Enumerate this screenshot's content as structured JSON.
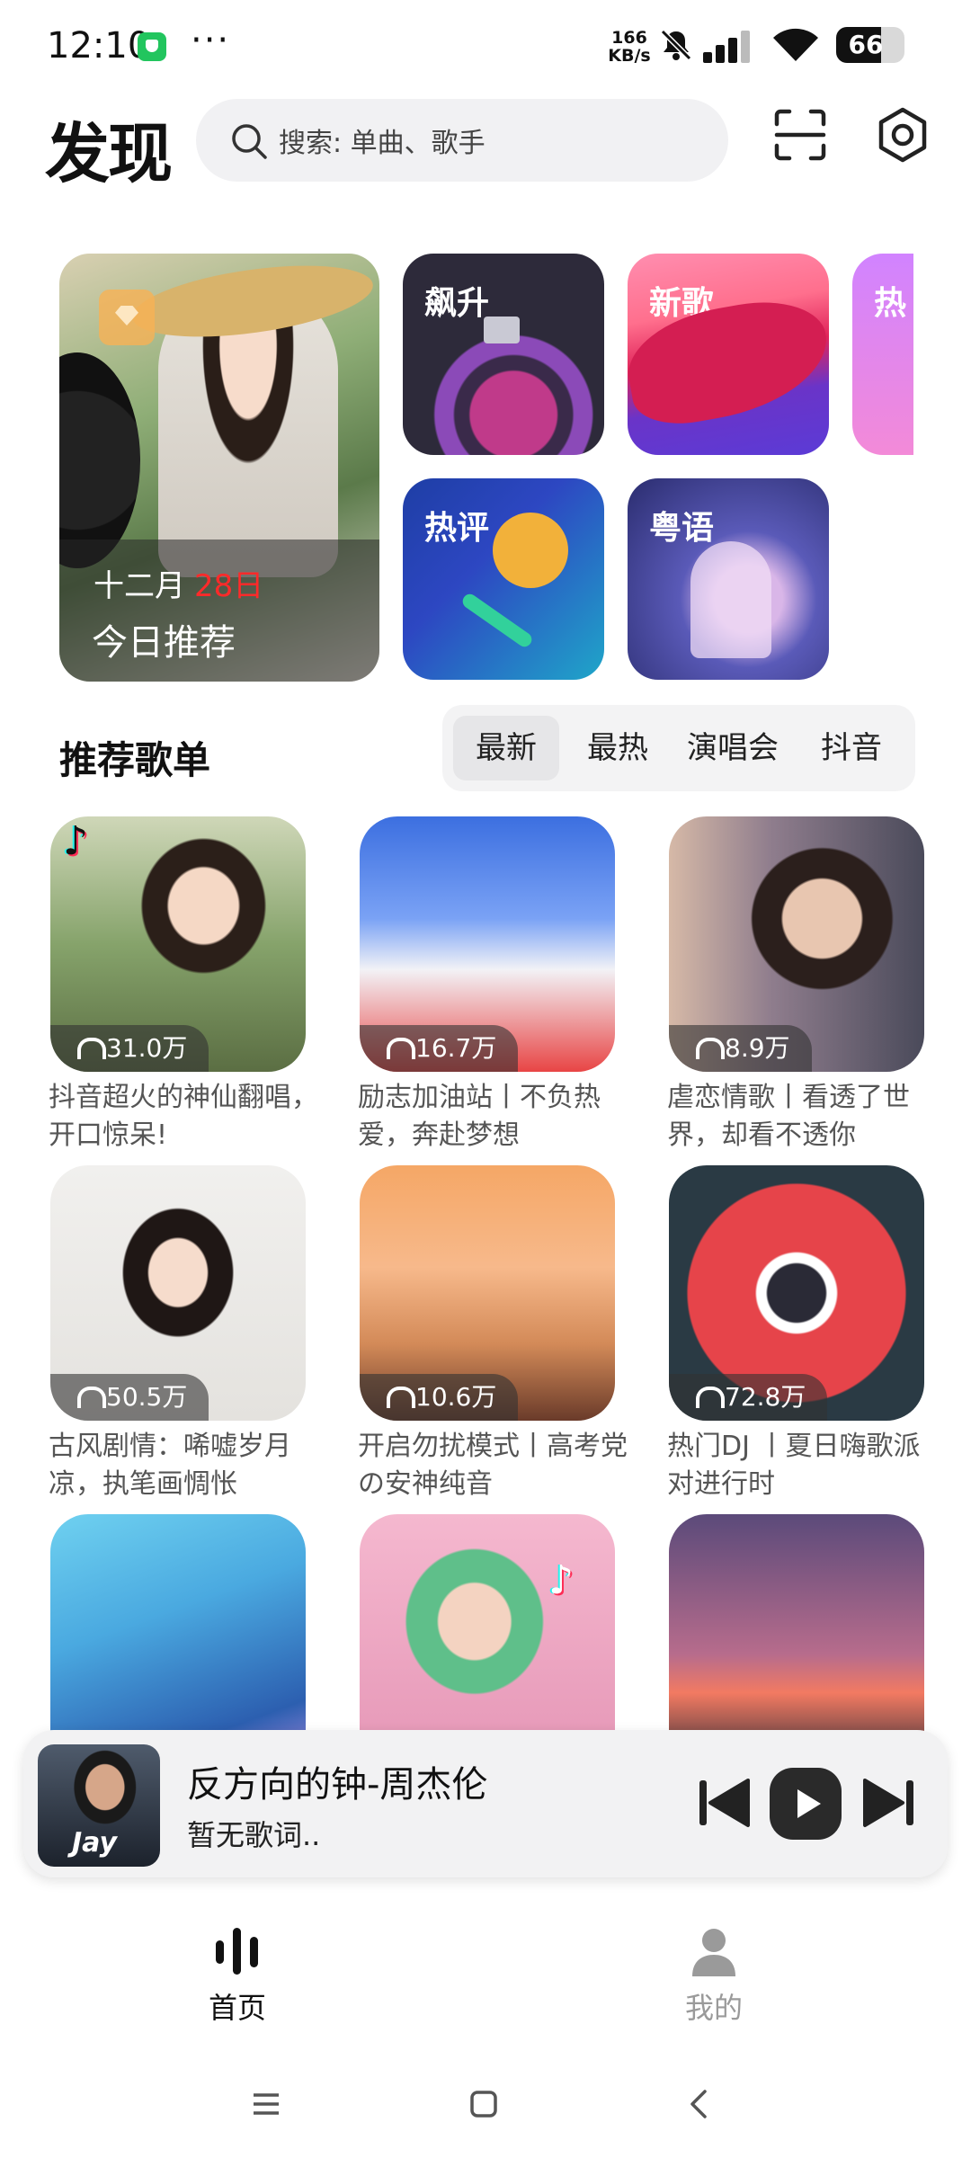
{
  "status": {
    "time": "12:10",
    "dots": "···",
    "speed_value": "166",
    "speed_unit": "KB/s",
    "battery": "66"
  },
  "header": {
    "title": "发现",
    "search_placeholder": "搜索: 单曲、歌手"
  },
  "hero": {
    "month": "十二月",
    "day": "28日",
    "label": "今日推荐",
    "tiles": [
      "飙升",
      "新歌",
      "热评",
      "粤语",
      "热"
    ]
  },
  "section": {
    "title": "推荐歌单",
    "tabs": [
      "最新",
      "最热",
      "演唱会",
      "抖音"
    ],
    "active_tab": "最新"
  },
  "playlists": [
    {
      "count": "31.0万",
      "title": "抖音超火的神仙翻唱，开口惊呆!"
    },
    {
      "count": "16.7万",
      "title": "励志加油站丨不负热爱，奔赴梦想"
    },
    {
      "count": "8.9万",
      "title": "虐恋情歌丨看透了世界，却看不透你"
    },
    {
      "count": "50.5万",
      "title": "古风剧情：唏嘘岁月凉，执笔画惆怅"
    },
    {
      "count": "10.6万",
      "title": "开启勿扰模式丨高考党の安神纯音"
    },
    {
      "count": "72.8万",
      "title": "热门DJ 丨夏日嗨歌派对进行时"
    },
    {
      "count": "",
      "title": ""
    },
    {
      "count": "",
      "title": ""
    },
    {
      "count": "",
      "title": ""
    }
  ],
  "player": {
    "song": "反方向的钟-周杰伦",
    "lyric": "暂无歌词..",
    "art_text": "Jay"
  },
  "nav": {
    "home": "首页",
    "mine": "我的"
  },
  "colors": {
    "accent_red": "#ff2a2a",
    "text_dark": "#111111",
    "text_muted": "#555555",
    "nav_inactive": "#9a9a9a"
  }
}
